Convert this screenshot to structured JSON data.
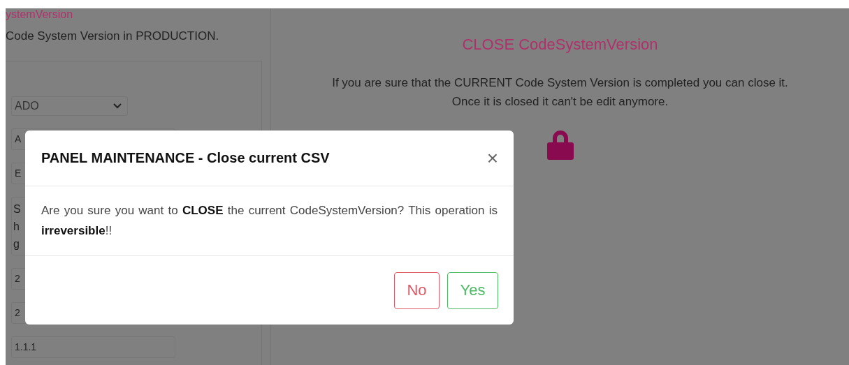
{
  "left_panel": {
    "title": "ystemVersion",
    "description": "Code System Version in PRODUCTION.",
    "select": {
      "value": "ADO"
    },
    "fields": [
      {
        "kind": "input",
        "lines": [
          "A"
        ]
      },
      {
        "kind": "input",
        "lines": [
          "E"
        ]
      },
      {
        "kind": "textarea",
        "lines": [
          "S",
          "h",
          "g"
        ]
      },
      {
        "kind": "input",
        "lines": [
          "2"
        ]
      },
      {
        "kind": "input",
        "lines": [
          "2"
        ]
      },
      {
        "kind": "input",
        "lines": [
          "1.1.1"
        ]
      }
    ]
  },
  "right_panel": {
    "title": "CLOSE CodeSystemVersion",
    "lines": [
      "If you are sure that the CURRENT Code System Version is completed you can close it.",
      "Once it is closed it can't be edit anymore."
    ]
  },
  "modal": {
    "title": "PANEL MAINTENANCE - Close current CSV",
    "close": "×",
    "message": "Are you sure you want to **CLOSE** the current CodeSystemVersion? This operation is **irreversible**!!",
    "buttons": [
      {
        "label": "No",
        "kind": "danger"
      },
      {
        "label": "Yes",
        "kind": "success"
      }
    ]
  }
}
